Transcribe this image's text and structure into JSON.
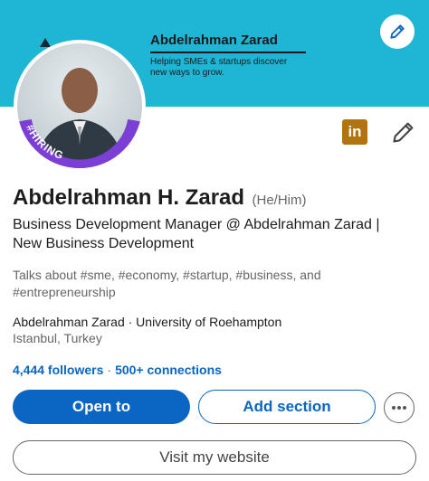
{
  "banner": {
    "name": "Abdelrahman Zarad",
    "tagline": "Helping SMEs & startups discover new ways to grow."
  },
  "avatar": {
    "badge": "#HIRING"
  },
  "icons": {
    "edit_banner": "pencil-icon",
    "linkedin": "linkedin-icon",
    "edit_profile": "pencil-icon",
    "more": "ellipsis-icon"
  },
  "linkedin_glyph": "in",
  "profile": {
    "name": "Abdelrahman H. Zarad",
    "pronouns": "(He/Him)",
    "headline": "Business Development Manager @ Abdelrahman Zarad | New Business Development",
    "talks_about": "Talks about #sme, #economy, #startup, #business, and #entrepreneurship",
    "education": "Abdelrahman Zarad · University of Roehampton",
    "location": "Istanbul, Turkey"
  },
  "network": {
    "followers": "4,444 followers",
    "separator": "·",
    "connections": "500+ connections"
  },
  "actions": {
    "open_to": "Open to",
    "add_section": "Add section",
    "visit_website": "Visit my website"
  },
  "colors": {
    "banner": "#1fb6d6",
    "primary": "#0a66c2",
    "hiring": "#7b3fd6",
    "linkedin_badge": "#b27411"
  }
}
